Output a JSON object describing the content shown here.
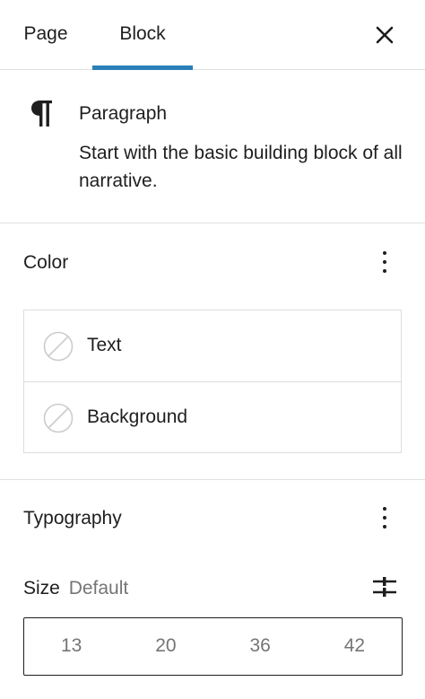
{
  "tabs": [
    {
      "label": "Page",
      "active": false
    },
    {
      "label": "Block",
      "active": true
    }
  ],
  "accent_color": "#2a7fb8",
  "close_icon": "close-icon",
  "block": {
    "icon": "paragraph-icon",
    "title": "Paragraph",
    "description": "Start with the basic building block of all narrative."
  },
  "color_panel": {
    "title": "Color",
    "items": [
      {
        "label": "Text",
        "icon": "empty-swatch-icon"
      },
      {
        "label": "Background",
        "icon": "empty-swatch-icon"
      }
    ]
  },
  "typography_panel": {
    "title": "Typography",
    "size_label": "Size",
    "size_value": "Default",
    "size_options": [
      "13",
      "20",
      "36",
      "42"
    ]
  }
}
